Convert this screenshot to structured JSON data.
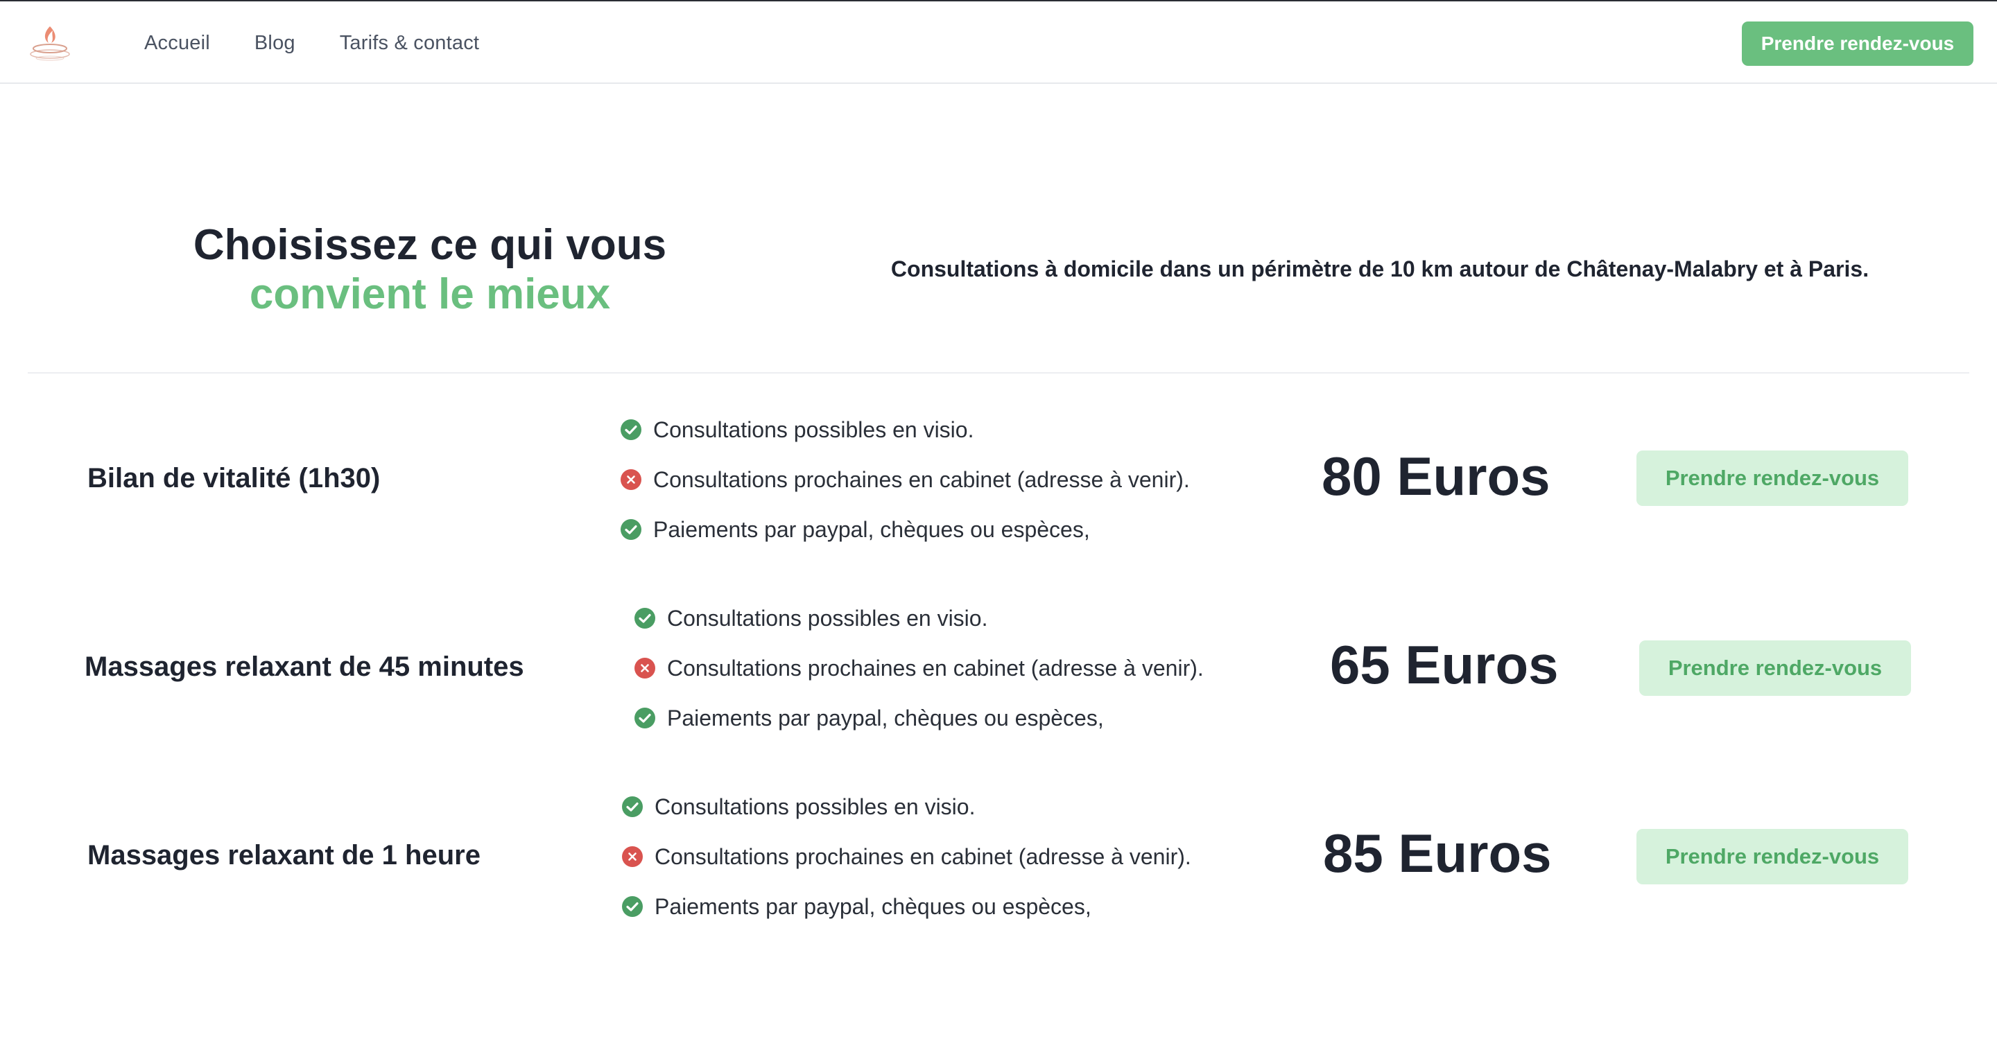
{
  "header": {
    "logo_alt": "logo",
    "nav": [
      {
        "label": "Accueil"
      },
      {
        "label": "Blog"
      },
      {
        "label": "Tarifs & contact"
      }
    ],
    "cta_label": "Prendre rendez-vous"
  },
  "hero": {
    "title_line1": "Choisissez ce qui vous",
    "title_line2": "convient le mieux",
    "subtitle": "Consultations à domicile dans un périmètre de 10 km autour de Châtenay-Malabry et à Paris."
  },
  "colors": {
    "accent": "#6abf7f",
    "cta_light_bg": "#d6f2dc",
    "check_green": "#4a9d63",
    "cross_red": "#d9534f"
  },
  "offers": [
    {
      "name": "Bilan de vitalité (1h30)",
      "features": [
        {
          "icon": "check-circle-icon",
          "text": "Consultations possibles en visio."
        },
        {
          "icon": "cross-circle-icon",
          "text": "Consultations prochaines en cabinet (adresse à venir)."
        },
        {
          "icon": "check-circle-icon",
          "text": "Paiements par paypal, chèques ou espèces,"
        }
      ],
      "price": "80 Euros",
      "cta_label": "Prendre rendez-vous"
    },
    {
      "name": "Massages relaxant de 45 minutes",
      "features": [
        {
          "icon": "check-circle-icon",
          "text": "Consultations possibles en visio."
        },
        {
          "icon": "cross-circle-icon",
          "text": "Consultations prochaines en cabinet (adresse à venir)."
        },
        {
          "icon": "check-circle-icon",
          "text": "Paiements par paypal, chèques ou espèces,"
        }
      ],
      "price": "65 Euros",
      "cta_label": "Prendre rendez-vous"
    },
    {
      "name": "Massages relaxant de 1 heure",
      "features": [
        {
          "icon": "check-circle-icon",
          "text": "Consultations possibles en visio."
        },
        {
          "icon": "cross-circle-icon",
          "text": "Consultations prochaines en cabinet (adresse à venir)."
        },
        {
          "icon": "check-circle-icon",
          "text": "Paiements par paypal, chèques ou espèces,"
        }
      ],
      "price": "85 Euros",
      "cta_label": "Prendre rendez-vous"
    }
  ]
}
